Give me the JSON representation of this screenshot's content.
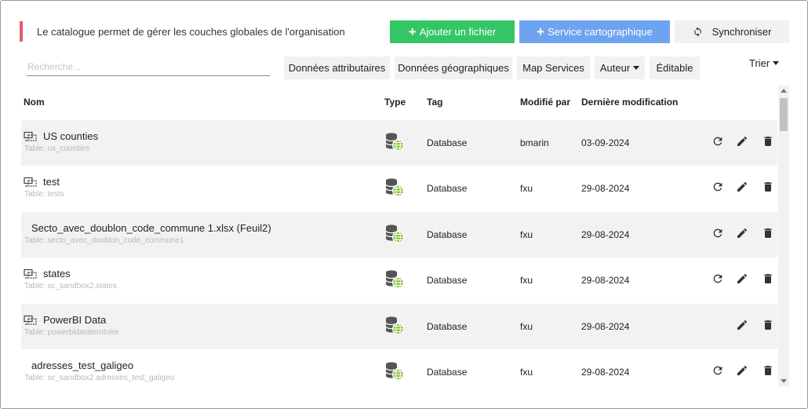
{
  "notice": {
    "text": "Le catalogue permet de gérer les couches globales de l'organisation"
  },
  "actions": {
    "add_file": "Ajouter un fichier",
    "map_service": "Service cartographique",
    "sync": "Synchroniser"
  },
  "search": {
    "placeholder": "Recherche...",
    "value": ""
  },
  "filters": {
    "attributes": "Données attributaires",
    "geographic": "Données géographiques",
    "map_services": "Map Services",
    "author": "Auteur",
    "editable": "Éditable"
  },
  "sort": {
    "label": "Trier"
  },
  "columns": {
    "name": "Nom",
    "type": "Type",
    "tag": "Tag",
    "modified_by": "Modifié par",
    "last_modified": "Dernière modification"
  },
  "rows": [
    {
      "name": "US counties",
      "table": "Table: us_counties",
      "tag": "Database",
      "user": "bmarin",
      "date": "03-09-2024",
      "layer_icon": true,
      "refresh": true
    },
    {
      "name": "test",
      "table": "Table: tests",
      "tag": "Database",
      "user": "fxu",
      "date": "29-08-2024",
      "layer_icon": true,
      "refresh": true
    },
    {
      "name": "Secto_avec_doublon_code_commune 1.xlsx (Feuil2)",
      "table": "Table: secto_avec_doublon_code_commune1",
      "tag": "Database",
      "user": "fxu",
      "date": "29-08-2024",
      "layer_icon": false,
      "refresh": true
    },
    {
      "name": "states",
      "table": "Table: sc_sandbox2.states",
      "tag": "Database",
      "user": "fxu",
      "date": "29-08-2024",
      "layer_icon": true,
      "refresh": true
    },
    {
      "name": "PowerBI Data",
      "table": "Table: powerbidataterritoire",
      "tag": "Database",
      "user": "fxu",
      "date": "29-08-2024",
      "layer_icon": true,
      "refresh": false
    },
    {
      "name": "adresses_test_galigeo",
      "table": "Table: sc_sandbox2.adresses_test_galigeo",
      "tag": "Database",
      "user": "fxu",
      "date": "29-08-2024",
      "layer_icon": false,
      "refresh": true
    }
  ],
  "colors": {
    "add": "#34c666",
    "service": "#6ea3ef",
    "notice_bar": "#e35d6a",
    "globe": "#8cc63f"
  },
  "icons": {
    "type": "database-globe-icon",
    "layer": "layers-icon",
    "refresh": "refresh-icon",
    "edit": "pencil-icon",
    "delete": "trash-icon",
    "sync": "sync-icon"
  }
}
